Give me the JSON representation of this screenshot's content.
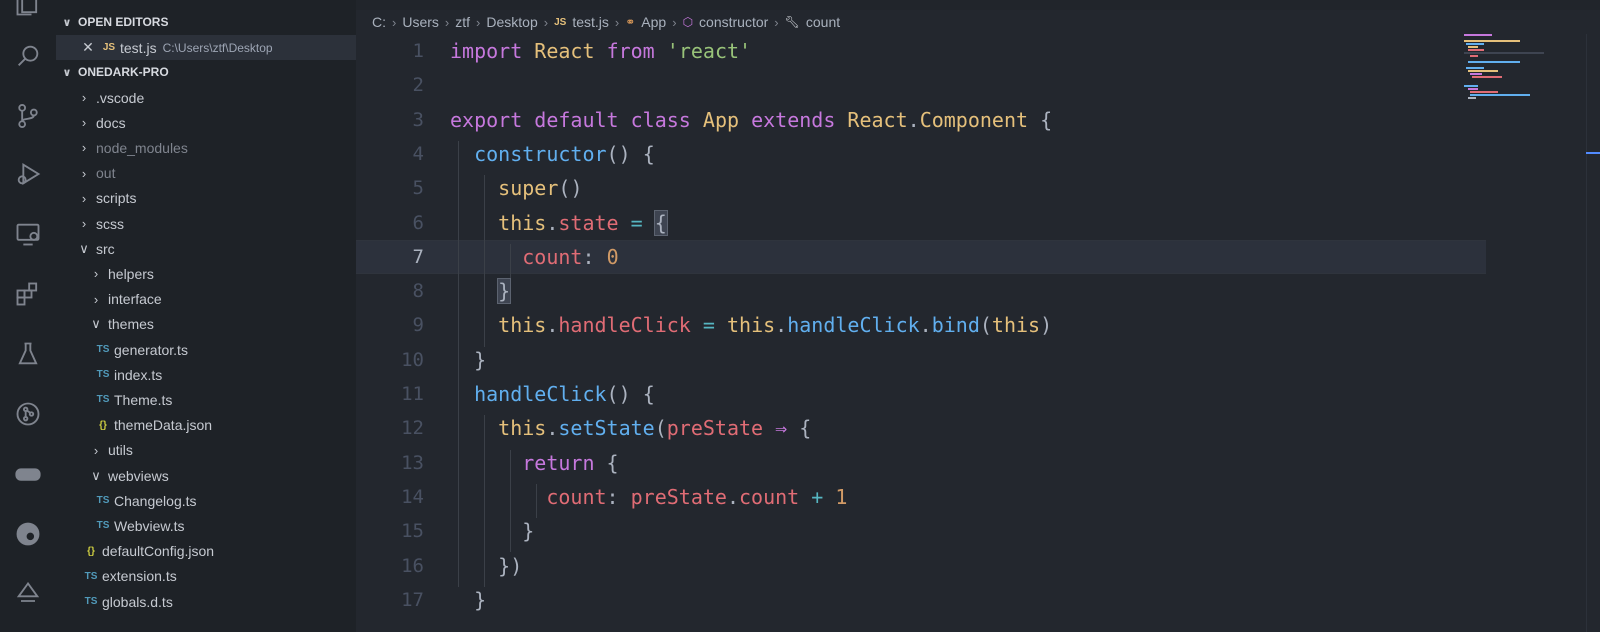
{
  "sidebar": {
    "open_editors_label": "OPEN EDITORS",
    "open_editor": {
      "icon": "JS",
      "name": "test.js",
      "path": "C:\\Users\\ztf\\Desktop"
    },
    "project_label": "ONEDARK-PRO",
    "items": [
      {
        "type": "folder",
        "name": ".vscode",
        "expanded": false
      },
      {
        "type": "folder",
        "name": "docs",
        "expanded": false
      },
      {
        "type": "folder",
        "name": "node_modules",
        "expanded": false,
        "dimmed": true
      },
      {
        "type": "folder",
        "name": "out",
        "expanded": false,
        "dimmed": true
      },
      {
        "type": "folder",
        "name": "scripts",
        "expanded": false
      },
      {
        "type": "folder",
        "name": "scss",
        "expanded": false
      },
      {
        "type": "folder",
        "name": "src",
        "expanded": true
      },
      {
        "type": "folder",
        "name": "helpers",
        "expanded": false
      },
      {
        "type": "folder",
        "name": "interface",
        "expanded": false
      },
      {
        "type": "folder",
        "name": "themes",
        "expanded": true
      },
      {
        "type": "file",
        "icon": "TS",
        "name": "generator.ts"
      },
      {
        "type": "file",
        "icon": "TS",
        "name": "index.ts"
      },
      {
        "type": "file",
        "icon": "TS",
        "name": "Theme.ts"
      },
      {
        "type": "file",
        "icon": "{}",
        "name": "themeData.json"
      },
      {
        "type": "folder",
        "name": "utils",
        "expanded": false
      },
      {
        "type": "folder",
        "name": "webviews",
        "expanded": true
      },
      {
        "type": "file",
        "icon": "TS",
        "name": "Changelog.ts"
      },
      {
        "type": "file",
        "icon": "TS",
        "name": "Webview.ts"
      },
      {
        "type": "file",
        "icon": "{}",
        "name": "defaultConfig.json"
      },
      {
        "type": "file",
        "icon": "TS",
        "name": "extension.ts"
      },
      {
        "type": "file",
        "icon": "TS",
        "name": "globals.d.ts"
      }
    ]
  },
  "breadcrumbs": [
    {
      "label": "C:"
    },
    {
      "label": "Users"
    },
    {
      "label": "ztf"
    },
    {
      "label": "Desktop"
    },
    {
      "label": "test.js",
      "icon": "JS"
    },
    {
      "label": "App",
      "icon": "class-icon"
    },
    {
      "label": "constructor",
      "icon": "method-icon"
    },
    {
      "label": "count",
      "icon": "property-icon"
    }
  ],
  "editor": {
    "active_line": 7,
    "lines": [
      {
        "n": "1",
        "code": "import React from 'react'"
      },
      {
        "n": "2",
        "code": ""
      },
      {
        "n": "3",
        "code": "export default class App extends React.Component {"
      },
      {
        "n": "4",
        "code": "  constructor() {"
      },
      {
        "n": "5",
        "code": "    super()"
      },
      {
        "n": "6",
        "code": "    this.state = {"
      },
      {
        "n": "7",
        "code": "      count: 0"
      },
      {
        "n": "8",
        "code": "    }"
      },
      {
        "n": "9",
        "code": "    this.handleClick = this.handleClick.bind(this)"
      },
      {
        "n": "10",
        "code": "  }"
      },
      {
        "n": "11",
        "code": "  handleClick() {"
      },
      {
        "n": "12",
        "code": "    this.setState(preState ⇒ {"
      },
      {
        "n": "13",
        "code": "      return {"
      },
      {
        "n": "14",
        "code": "        count: preState.count + 1"
      },
      {
        "n": "15",
        "code": "      }"
      },
      {
        "n": "16",
        "code": "    })"
      },
      {
        "n": "17",
        "code": "  }"
      }
    ]
  },
  "colors": {
    "keyword": "#c678dd",
    "class": "#e5c07b",
    "string": "#98c379",
    "function": "#61afef",
    "property": "#e06c75",
    "number": "#d19a66",
    "operator": "#56b6c2",
    "background": "#23272e",
    "sidebar": "#1e2227"
  },
  "activity_bar": [
    "explorer-icon",
    "search-icon",
    "source-control-icon",
    "run-debug-icon",
    "remote-explorer-icon",
    "extensions-icon",
    "testing-icon",
    "git-graph-icon",
    "gamepad-icon",
    "edge-icon",
    "gitlens-icon"
  ]
}
